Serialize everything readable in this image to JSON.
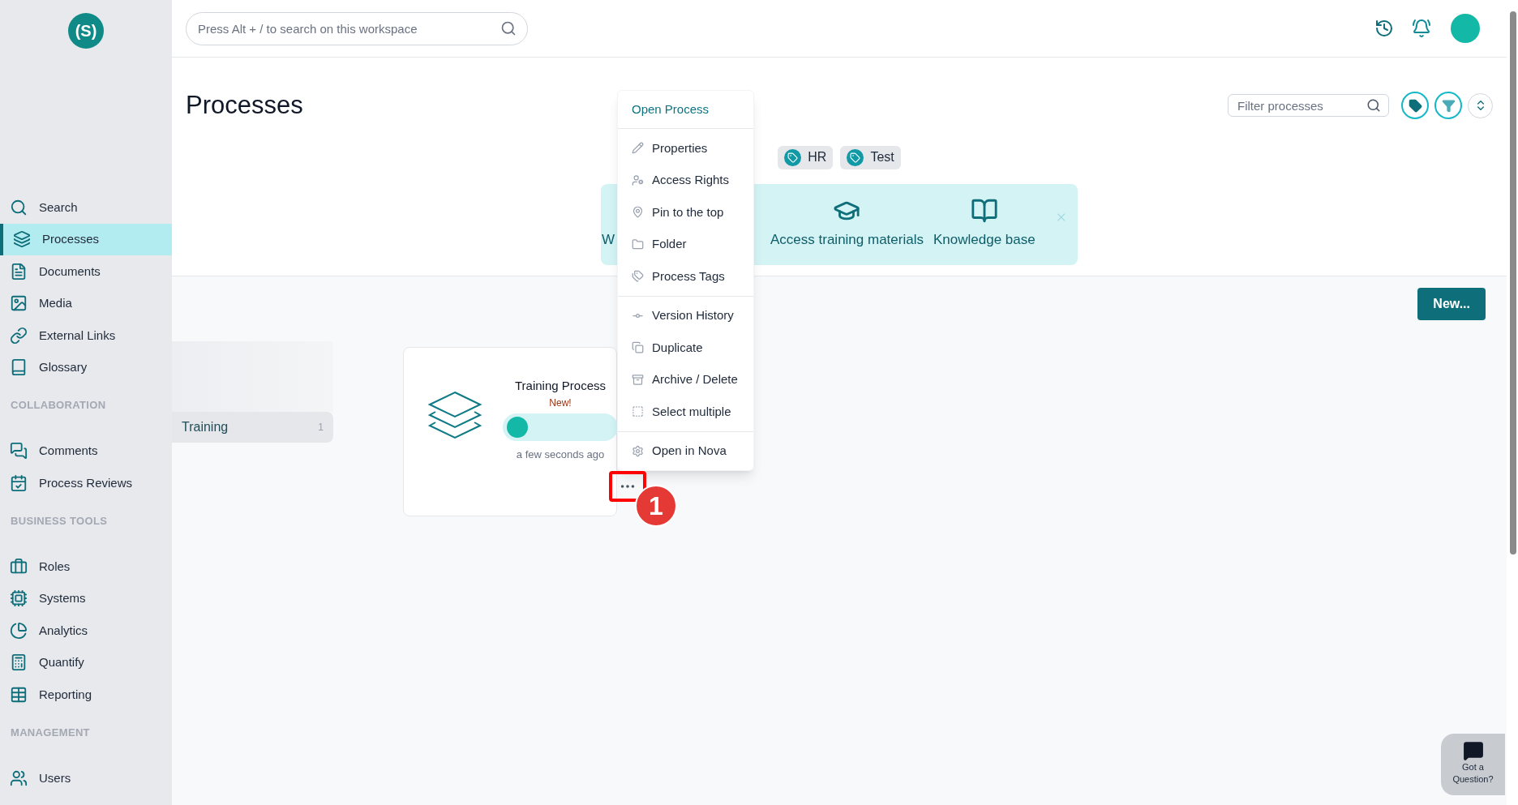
{
  "logo": {
    "text": "(S)"
  },
  "sidebar": {
    "sections": [
      {
        "items": [
          {
            "label": "Search",
            "selected": false
          },
          {
            "label": "Processes",
            "selected": true
          },
          {
            "label": "Documents",
            "selected": false
          },
          {
            "label": "Media",
            "selected": false
          },
          {
            "label": "External Links",
            "selected": false
          },
          {
            "label": "Glossary",
            "selected": false
          }
        ]
      },
      {
        "heading": "COLLABORATION",
        "items": [
          {
            "label": "Comments",
            "selected": false
          },
          {
            "label": "Process Reviews",
            "selected": false
          }
        ]
      },
      {
        "heading": "BUSINESS TOOLS",
        "items": [
          {
            "label": "Roles",
            "selected": false
          },
          {
            "label": "Systems",
            "selected": false
          },
          {
            "label": "Analytics",
            "selected": false
          },
          {
            "label": "Quantify",
            "selected": false
          },
          {
            "label": "Reporting",
            "selected": false
          }
        ]
      },
      {
        "heading": "MANAGEMENT",
        "items": [
          {
            "label": "Users",
            "selected": false
          }
        ]
      }
    ]
  },
  "search": {
    "placeholder": "Press Alt + / to search on this workspace"
  },
  "page_title": "Processes",
  "filter": {
    "placeholder": "Filter processes"
  },
  "tags": [
    "HR",
    "Test"
  ],
  "banner": {
    "items": [
      {
        "label": "W",
        "kind": "text"
      },
      {
        "label": "Access training materials",
        "kind": "training"
      },
      {
        "label": "Knowledge base",
        "kind": "knowledge"
      }
    ]
  },
  "new_button": "New...",
  "folders": [
    {
      "name": "Training",
      "count": "1",
      "selected": true
    }
  ],
  "card": {
    "title": "Training Process",
    "badge": "New!",
    "time": "a few seconds ago"
  },
  "context_menu": {
    "sections": [
      [
        {
          "label": "Open Process",
          "kind": "primary"
        }
      ],
      [
        {
          "label": "Properties",
          "kind": "item"
        },
        {
          "label": "Access Rights",
          "kind": "item"
        },
        {
          "label": "Pin to the top",
          "kind": "item"
        },
        {
          "label": "Folder",
          "kind": "item"
        },
        {
          "label": "Process Tags",
          "kind": "item"
        }
      ],
      [
        {
          "label": "Version History",
          "kind": "item"
        },
        {
          "label": "Duplicate",
          "kind": "item"
        },
        {
          "label": "Archive / Delete",
          "kind": "item"
        },
        {
          "label": "Select multiple",
          "kind": "item"
        }
      ],
      [
        {
          "label": "Open in Nova",
          "kind": "item"
        }
      ]
    ]
  },
  "annotation": {
    "label": "1"
  },
  "help_widget": {
    "label": "Got a Question?"
  }
}
